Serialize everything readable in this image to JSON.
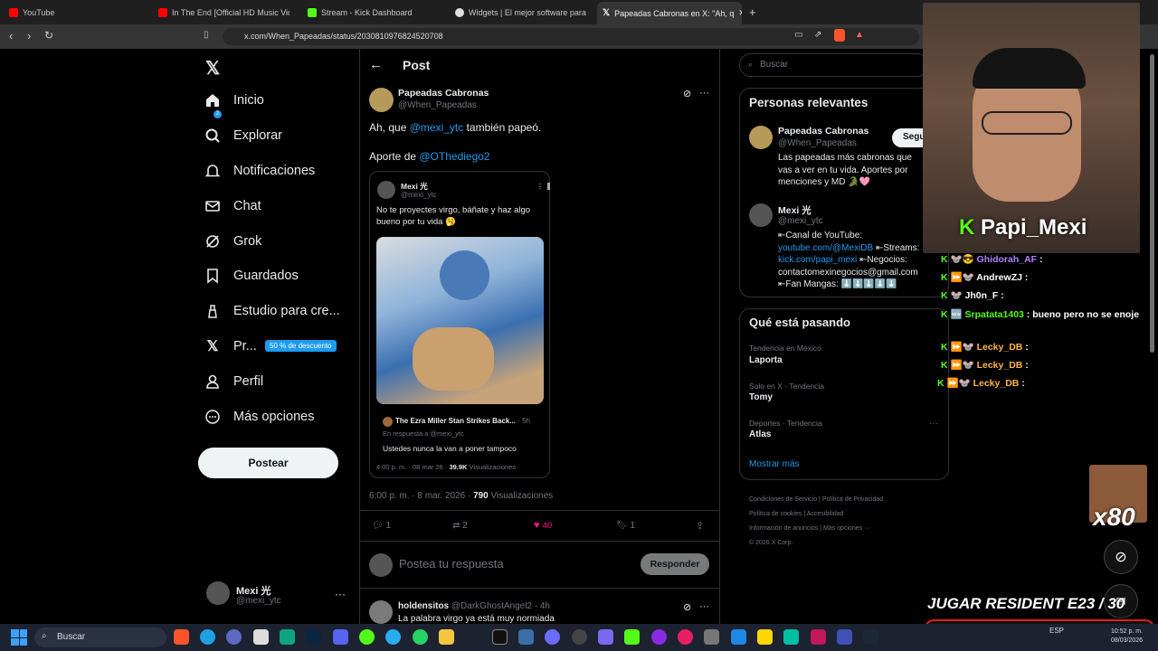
{
  "browser": {
    "tabs": [
      {
        "label": "YouTube",
        "color": "#ff0000"
      },
      {
        "label": "In The End [Official HD Music Vid",
        "color": "#ff0000"
      },
      {
        "label": "Stream - Kick Dashboard",
        "color": "#53fc18"
      },
      {
        "label": "Widgets | El mejor software para pot",
        "color": "#dddddd"
      },
      {
        "label": "Papeadas Cabronas en X: \"Ah, q",
        "color": "#ffffff"
      }
    ],
    "url": "x.com/When_Papeadas/status/2030810976824520708"
  },
  "sidebar": {
    "items": [
      {
        "label": "Inicio",
        "icon": "home-icon"
      },
      {
        "label": "Explorar",
        "icon": "search-icon"
      },
      {
        "label": "Notificaciones",
        "icon": "bell-icon"
      },
      {
        "label": "Chat",
        "icon": "mail-icon"
      },
      {
        "label": "Grok",
        "icon": "grok-icon"
      },
      {
        "label": "Guardados",
        "icon": "bookmark-icon"
      },
      {
        "label": "Estudio para cre...",
        "icon": "studio-icon"
      },
      {
        "label": "Pr...",
        "icon": "x-icon"
      },
      {
        "label": "Perfil",
        "icon": "person-icon"
      },
      {
        "label": "Más opciones",
        "icon": "more-icon"
      }
    ],
    "notif_count": "2",
    "premium_badge": "50 % de descuento",
    "post_button": "Postear",
    "account": {
      "name": "Mexi 光",
      "handle": "@mexi_ytc"
    }
  },
  "main": {
    "title": "Post",
    "post": {
      "author": "Papeadas Cabronas",
      "handle": "@When_Papeadas",
      "text_pre": "Ah, que ",
      "mention": "@mexi_ytc",
      "text_post": " también papeó.",
      "line2_pre": "Aporte de ",
      "line2_mention": "@OThediego2",
      "quote": {
        "author": "Mexi 光",
        "handle": "@mexi_ytc",
        "text": "No te proyectes virgo, báñate y haz algo bueno por tu vida 🥱",
        "reply_author": "The Ezra Miller Stan Strikes Back...",
        "reply_time": "5h",
        "reply_to": "En respuesta a @mexi_ytc",
        "reply_text": "Ustedes nunca la van a poner tampoco",
        "meta_time": "4:00 p. m. · 08 mar 26 · ",
        "meta_views": "39.9K",
        "meta_views_label": " Visualizaciones"
      },
      "timestamp": "6:00 p. m. · 8 mar. 2026 · ",
      "views": "790",
      "views_label": " Visualizaciones",
      "replies": "1",
      "reposts": "2",
      "likes": "40",
      "bookmarks": "1"
    },
    "reply_placeholder": "Postea tu respuesta",
    "reply_button": "Responder",
    "next_reply": {
      "author": "holdensitos",
      "handle": "@DarkGhostAngel2 · 4h",
      "text": "La palabra virgo ya está muy normiada"
    }
  },
  "right": {
    "search_placeholder": "Buscar",
    "relevant_title": "Personas relevantes",
    "people": [
      {
        "name": "Papeadas Cabronas",
        "handle": "@When_Papeadas",
        "bio": "Las papeadas más cabronas que vas a ver en tu vida. Aportes por menciones y MD 🐊🩷",
        "follow": "Seguir"
      },
      {
        "name": "Mexi 光",
        "handle": "@mexi_ytc",
        "bio1": "⇤Canal de YouTube:",
        "link1": "youtube.com/@MexiDB",
        "bio2": " ⇤Streams:",
        "link2": "kick.com/papi_mexi",
        "bio3": " ⇤Negocios:",
        "bio4": "contactomexinegocios@gmail.com",
        "bio5": "⇤Fan Mangas: ⬇️⬇️⬇️⬇️⬇️"
      }
    ],
    "trends_title": "Qué está pasando",
    "trends": [
      {
        "context": "Tendencia en México",
        "name": "Laporta"
      },
      {
        "context": "Solo en X · Tendencia",
        "name": "Tomy"
      },
      {
        "context": "Deportes · Tendencia",
        "name": "Atlas"
      }
    ],
    "show_more": "Mostrar más",
    "footer": [
      "Condiciones de Servicio",
      "Política de Privacidad",
      "Política de cookies",
      "Accesibilidad",
      "Información de anuncios",
      "Más opciones ···",
      "© 2026 X Corp."
    ]
  },
  "overlay": {
    "streamer": "Papi_Mexi",
    "chat": [
      {
        "user": "Ghidorah_AF",
        "msg": " :",
        "color": "#b080ff"
      },
      {
        "user": "AndrewZJ",
        "msg": " :",
        "color": "#ffffff"
      },
      {
        "user": "Jh0n_F",
        "msg": " :",
        "color": "#ffffff"
      },
      {
        "user": "Srpatata1403",
        "msg": " : bueno pero no se enoje",
        "color": "#53fc18"
      },
      {
        "user": "Lecky_DB",
        "msg": " :",
        "color": "#ffb347"
      },
      {
        "user": "Lecky_DB",
        "msg": " :",
        "color": "#ffb347"
      },
      {
        "user": "Lecky_DB",
        "msg": " :",
        "color": "#ffb347"
      }
    ],
    "multiplier": "x80",
    "goal_text": "JUGAR RESIDENT E23",
    "goal_count": "/ 30",
    "goal_progress": 0.92
  },
  "taskbar": {
    "search": "Buscar",
    "time": "10:52 p. m.",
    "date": "08/03/2026",
    "lang": "ESP"
  }
}
